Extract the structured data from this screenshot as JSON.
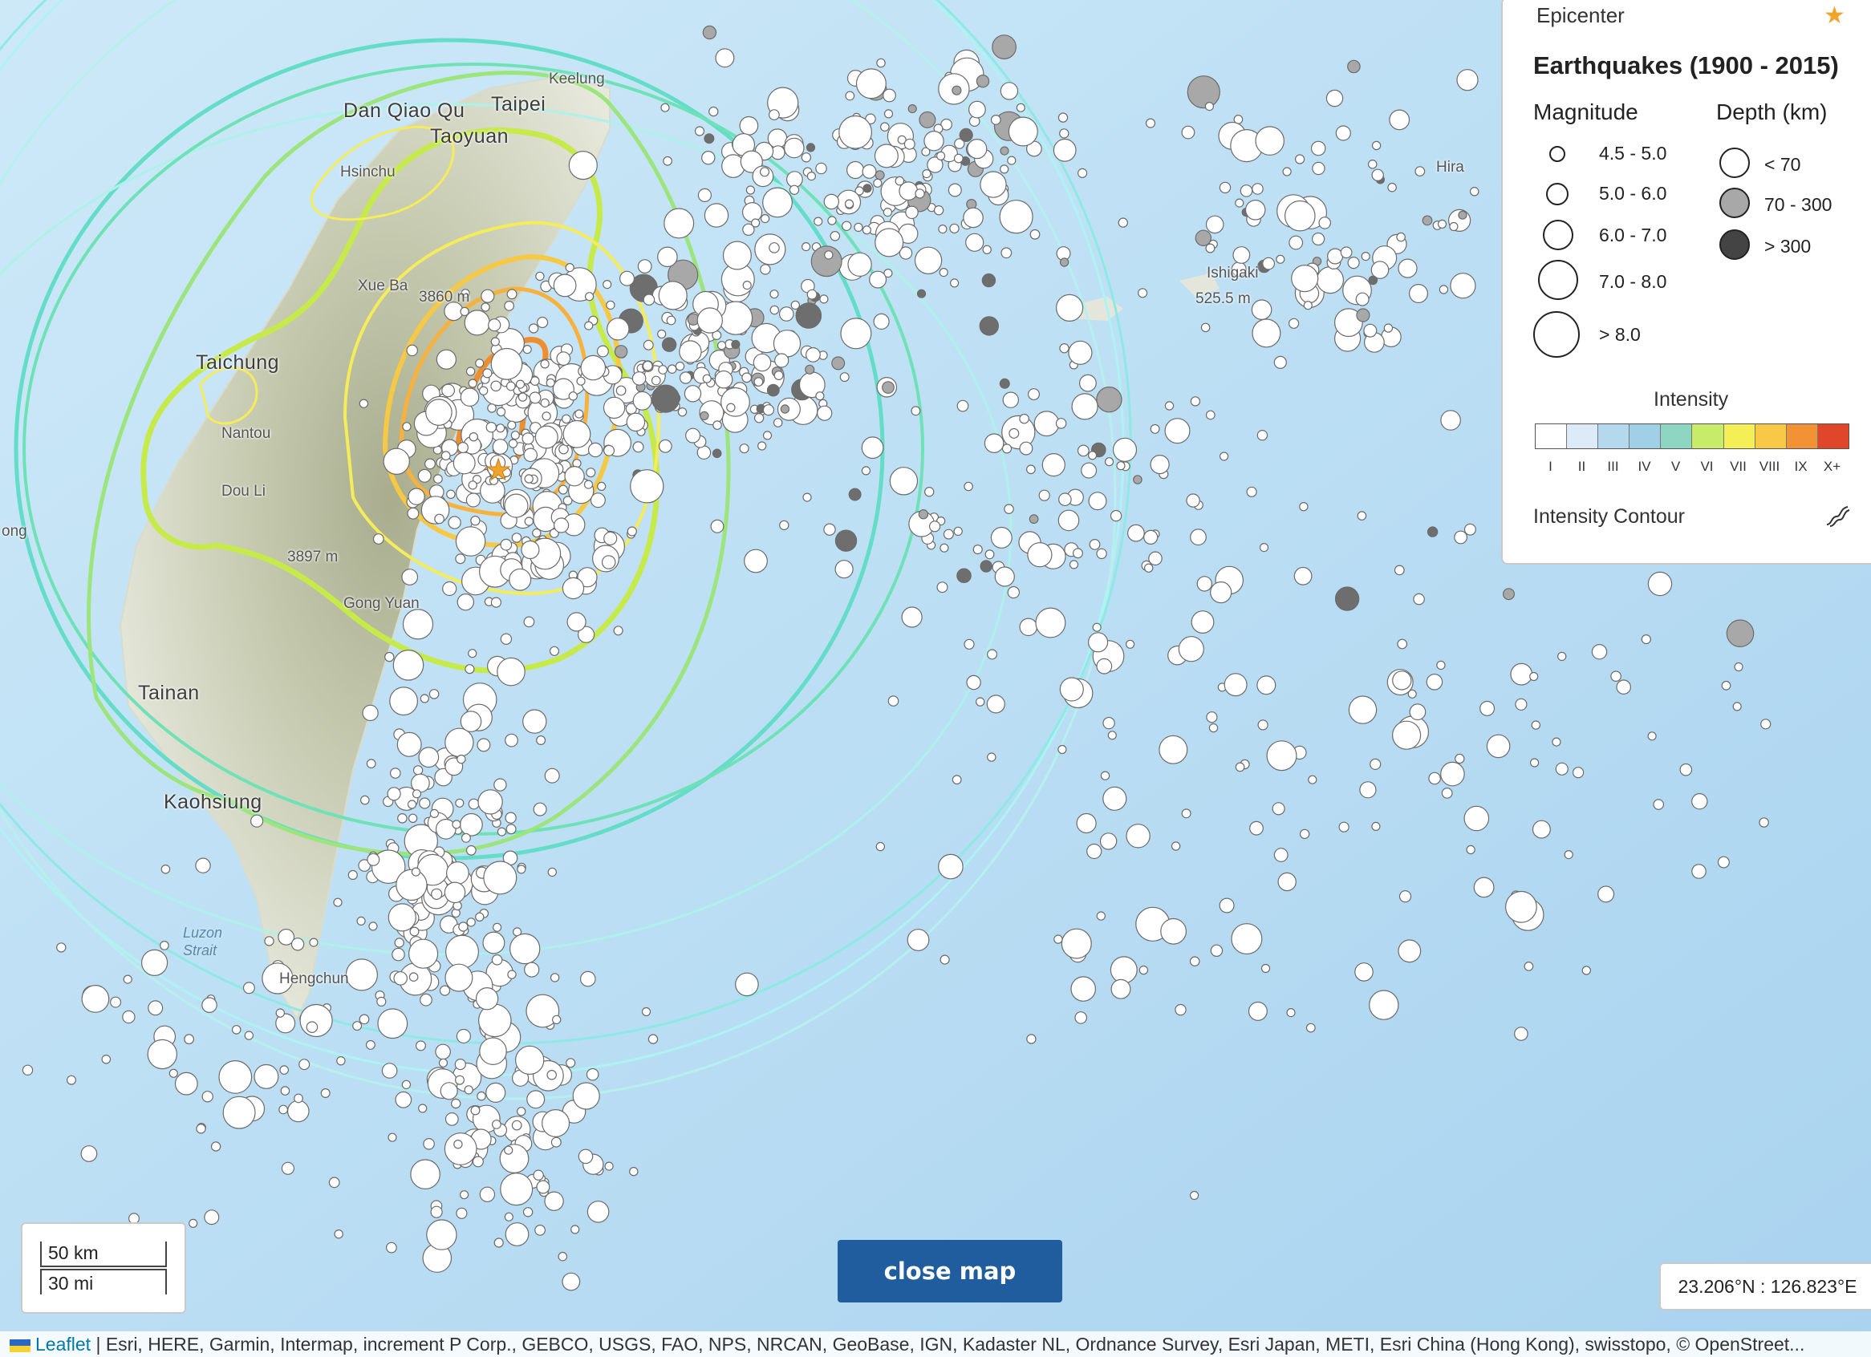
{
  "map": {
    "places": [
      {
        "name": "Keelung",
        "size": "small"
      },
      {
        "name": "Dan Qiao Qu",
        "size": "big"
      },
      {
        "name": "Taipei",
        "size": "big"
      },
      {
        "name": "Taoyuan",
        "size": "big"
      },
      {
        "name": "Hsinchu",
        "size": "small"
      },
      {
        "name": "Taichung",
        "size": "big"
      },
      {
        "name": "Nantou",
        "size": "small"
      },
      {
        "name": "Dou Li",
        "size": "small"
      },
      {
        "name": "Tainan",
        "size": "big"
      },
      {
        "name": "Kaohsiung",
        "size": "big"
      },
      {
        "name": "Hengchun",
        "size": "small"
      },
      {
        "name": "Ishigaki",
        "size": "small"
      },
      {
        "name": "Hira",
        "size": "small"
      },
      {
        "name": "ong",
        "size": "small"
      },
      {
        "name": "Gong Yuan",
        "size": "small"
      },
      {
        "name": "Xue Ba",
        "size": "small"
      },
      {
        "name": "3860 m",
        "size": "small"
      },
      {
        "name": "3897 m",
        "size": "small"
      },
      {
        "name": "525.5 m",
        "size": "small"
      },
      {
        "name": "Luzon Strait",
        "size": "water"
      }
    ]
  },
  "legend": {
    "epicenter_label": "Epicenter",
    "title": "Earthquakes (1900 - 2015)",
    "magnitude_header": "Magnitude",
    "depth_header": "Depth (km)",
    "magnitudes": [
      "4.5 - 5.0",
      "5.0 - 6.0",
      "6.0 - 7.0",
      "7.0 - 8.0",
      "> 8.0"
    ],
    "depths": [
      {
        "label": "< 70",
        "color": "#ffffff"
      },
      {
        "label": "70 - 300",
        "color": "#a8a8a8"
      },
      {
        "label": "> 300",
        "color": "#444444"
      }
    ],
    "intensity_label": "Intensity",
    "intensity_colors": [
      "#ffffff",
      "#dcebf7",
      "#b4d8ec",
      "#9fd0e6",
      "#8fd6c2",
      "#c6ec6a",
      "#f4ef54",
      "#f8c944",
      "#f29235",
      "#e0472a"
    ],
    "intensity_ticks": [
      "I",
      "II",
      "III",
      "IV",
      "V",
      "VI",
      "VII",
      "VIII",
      "IX",
      "X+"
    ],
    "contour_label": "Intensity Contour"
  },
  "scalebar": {
    "km": "50 km",
    "mi": "30 mi"
  },
  "close_button": "close map",
  "coordinates": "23.206°N : 126.823°E",
  "attribution": {
    "leaflet": "Leaflet",
    "text": " | Esri, HERE, Garmin, Intermap, increment P Corp., GEBCO, USGS, FAO, NPS, NRCAN, GeoBase, IGN, Kadaster NL, Ordnance Survey, Esri Japan, METI, Esri China (Hong Kong), swisstopo, © OpenStreet..."
  }
}
